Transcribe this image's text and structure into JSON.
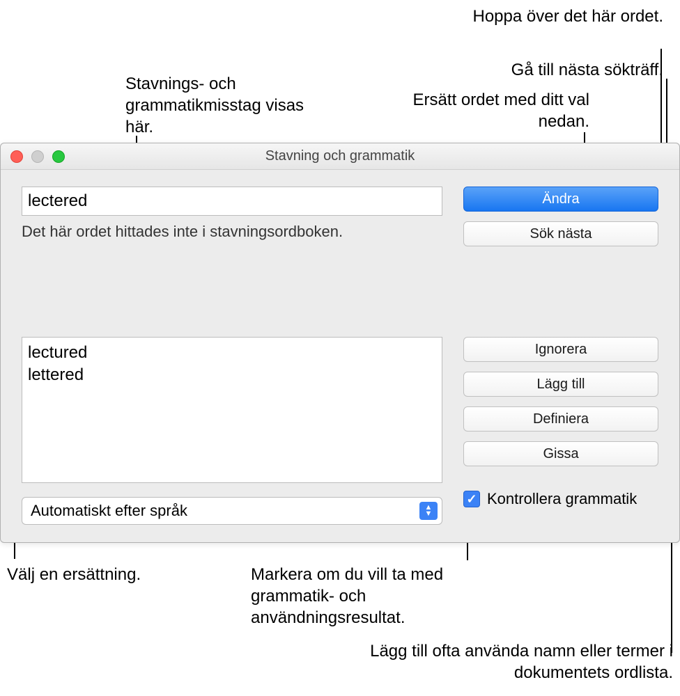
{
  "callouts": {
    "mistakes": "Stavnings- och grammatikmisstag visas här.",
    "skip": "Hoppa över det här ordet.",
    "next": "Gå till nästa sökträff.",
    "replace": "Ersätt ordet med ditt val nedan.",
    "choose": "Välj en ersättning.",
    "grammar": "Markera om du vill ta med grammatik- och användningsresultat.",
    "add": "Lägg till ofta använda namn eller termer i dokumentets ordlista."
  },
  "window": {
    "title": "Stavning och grammatik",
    "misspelled_word": "lectered",
    "status": "Det här ordet hittades inte i stavningsordboken.",
    "suggestions": [
      "lectured",
      "lettered"
    ],
    "language_select": "Automatiskt efter språk",
    "checkbox_label": "Kontrollera grammatik",
    "buttons": {
      "change": "Ändra",
      "find_next": "Sök nästa",
      "ignore": "Ignorera",
      "add": "Lägg till",
      "define": "Definiera",
      "guess": "Gissa"
    }
  }
}
